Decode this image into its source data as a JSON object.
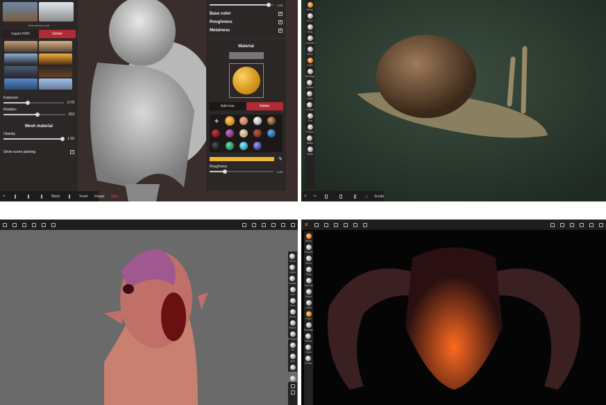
{
  "colors": {
    "accent_red": "#b02a35",
    "accent_orange": "#e08a2a",
    "panel": "#2b2727",
    "toolbar": "#1e1e1e"
  },
  "q1": {
    "env_label": "environment_hdr",
    "import_hdr": "Import HDR",
    "delete": "Delete",
    "exposure_label": "Exposure",
    "exposure_value": "0.75",
    "rotation_label": "Rotation",
    "rotation_value": "203",
    "mesh_material_title": "Mesh material",
    "opacity_label": "Opacity",
    "opacity_value": "1.00",
    "show_scene_painting": "Show scene painting",
    "top_slider_value": "1.00",
    "base_color": "Base color",
    "roughness": "Roughness",
    "metalness": "Metalness",
    "material_title": "Material",
    "add_new": "Add new",
    "delete_material": "Delete",
    "roughness_label": "Roughness",
    "roughness_value": "0.24",
    "bottom_mask": "Mask",
    "bottom_voxel": "Voxel",
    "bottom_state": "Visage",
    "bottom_sym": "Sym"
  },
  "q2": {
    "tools": [
      "Brush",
      "Move",
      "Drag",
      "Smooth",
      "Mask",
      "Paint",
      "Smudge",
      "Flatten",
      "Layer",
      "Crease",
      "Trim",
      "Project",
      "Inflate",
      "Mask"
    ],
    "bottom_label": "Sculpt"
  },
  "q3": {
    "tools": [
      "Pinch",
      "Layer",
      "Nudge",
      "Line",
      "Rect",
      "Brush",
      "Ellipse",
      "Polygon",
      "Fill",
      "Spin",
      "Smooth",
      "Mask"
    ]
  },
  "q4": {
    "tools": [
      "Brush",
      "Smooth",
      "Move",
      "Drag",
      "Smooth",
      "Mask",
      "Lasso",
      "Paint",
      "Smudge",
      "Flatten",
      "Layer",
      "Crease"
    ]
  }
}
